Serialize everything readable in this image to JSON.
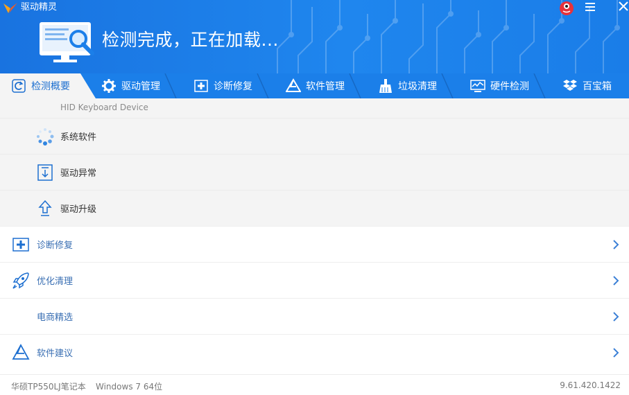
{
  "app": {
    "title": "驱动精灵"
  },
  "header": {
    "status": "检测完成，正在加载..."
  },
  "tabs": [
    {
      "label": "检测概要",
      "icon": "refresh-icon"
    },
    {
      "label": "驱动管理",
      "icon": "gear-icon"
    },
    {
      "label": "诊断修复",
      "icon": "medical-cross-icon"
    },
    {
      "label": "软件管理",
      "icon": "triangle-app-icon"
    },
    {
      "label": "垃圾清理",
      "icon": "broom-icon"
    },
    {
      "label": "硬件检测",
      "icon": "monitor-chart-icon"
    },
    {
      "label": "百宝箱",
      "icon": "dropbox-icon"
    }
  ],
  "scan": {
    "current_device": "HID Keyboard Device",
    "items": [
      {
        "label": "系统软件",
        "icon": "loading-spinner-icon"
      },
      {
        "label": "驱动异常",
        "icon": "download-box-icon"
      },
      {
        "label": "驱动升级",
        "icon": "upload-arrow-icon"
      }
    ]
  },
  "sections": [
    {
      "label": "诊断修复",
      "icon": "medical-cross-icon"
    },
    {
      "label": "优化清理",
      "icon": "rocket-icon"
    },
    {
      "label": "电商精选",
      "icon": ""
    },
    {
      "label": "软件建议",
      "icon": "triangle-app-icon"
    }
  ],
  "footer": {
    "device": "华硕TP550LJ笔记本",
    "os": "Windows 7 64位",
    "version": "9.61.420.1422"
  }
}
